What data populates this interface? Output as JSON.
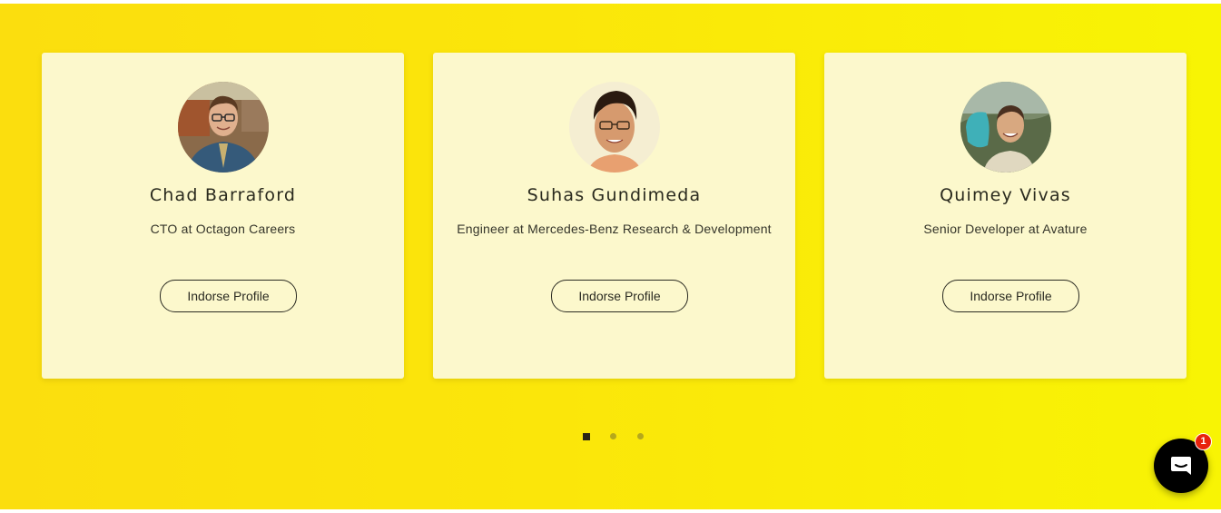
{
  "profiles": [
    {
      "name": "Chad Barraford",
      "role": "CTO at Octagon Careers",
      "button_label": "Indorse Profile",
      "avatar_icon": "person-photo-avatar"
    },
    {
      "name": "Suhas Gundimeda",
      "role": "Engineer at Mercedes-Benz Research & Development",
      "button_label": "Indorse Profile",
      "avatar_icon": "person-photo-avatar"
    },
    {
      "name": "Quimey Vivas",
      "role": "Senior Developer at Avature",
      "button_label": "Indorse Profile",
      "avatar_icon": "person-photo-avatar"
    }
  ],
  "carousel": {
    "page_count": 3,
    "active_page": 1
  },
  "chat_widget": {
    "icon": "chat-bubble-icon",
    "badge_count": "1"
  },
  "colors": {
    "background_start": "#fbde0e",
    "background_end": "#f8f404",
    "card": "#fcf8cc",
    "chat_button": "#000000",
    "badge": "#e8230c"
  }
}
